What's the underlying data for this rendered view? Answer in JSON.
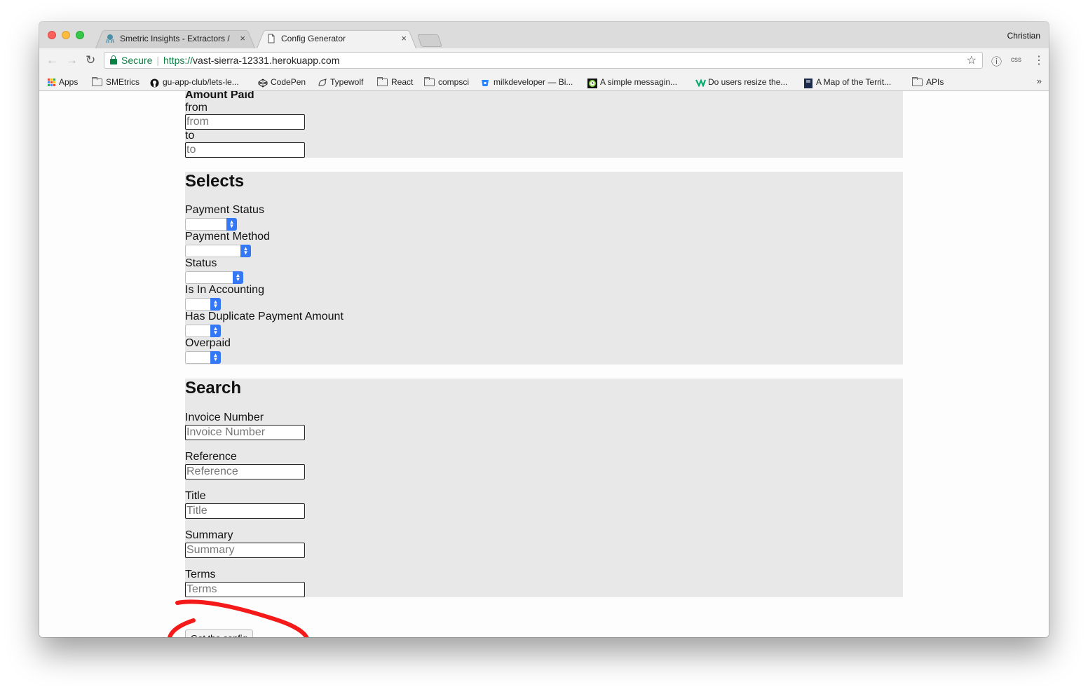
{
  "browser": {
    "profile_name": "Christian",
    "tabs": [
      {
        "title": "Smetric Insights - Extractors /",
        "active": false
      },
      {
        "title": "Config Generator",
        "active": true
      }
    ],
    "close_glyph": "×",
    "address": {
      "secure_label": "Secure",
      "scheme": "https://",
      "host": "vast-sierra-12331.herokuapp.com"
    },
    "toolbar_extension_label": "css",
    "bookmarks": [
      {
        "label": "Apps",
        "icon": "apps-grid-icon"
      },
      {
        "label": "SMEtrics",
        "icon": "folder-icon"
      },
      {
        "label": "gu-app-club/lets-le...",
        "icon": "github-icon"
      },
      {
        "label": "CodePen",
        "icon": "codepen-icon"
      },
      {
        "label": "Typewolf",
        "icon": "typewolf-icon"
      },
      {
        "label": "React",
        "icon": "folder-icon"
      },
      {
        "label": "compsci",
        "icon": "folder-icon"
      },
      {
        "label": "milkdeveloper — Bi...",
        "icon": "bitbucket-icon"
      },
      {
        "label": "A simple messagin...",
        "icon": "clock-icon"
      },
      {
        "label": "Do users resize the...",
        "icon": "medium-icon"
      },
      {
        "label": "A Map of the Territ...",
        "icon": "book-icon"
      },
      {
        "label": "APIs",
        "icon": "folder-icon"
      }
    ],
    "bookmarks_overflow": "»"
  },
  "page": {
    "amount_paid": {
      "heading": "Amount Paid",
      "from_label": "from",
      "from_placeholder": "from",
      "to_label": "to",
      "to_placeholder": "to"
    },
    "selects": {
      "heading": "Selects",
      "fields": [
        {
          "label": "Payment Status",
          "value": ""
        },
        {
          "label": "Payment Method",
          "value": ""
        },
        {
          "label": "Status",
          "value": ""
        },
        {
          "label": "Is In Accounting",
          "value": ""
        },
        {
          "label": "Has Duplicate Payment Amount",
          "value": ""
        },
        {
          "label": "Overpaid",
          "value": ""
        }
      ]
    },
    "search": {
      "heading": "Search",
      "fields": [
        {
          "label": "Invoice Number",
          "placeholder": "Invoice Number"
        },
        {
          "label": "Reference",
          "placeholder": "Reference"
        },
        {
          "label": "Title",
          "placeholder": "Title"
        },
        {
          "label": "Summary",
          "placeholder": "Summary"
        },
        {
          "label": "Terms",
          "placeholder": "Terms"
        }
      ]
    },
    "submit_label": "Get the config"
  },
  "colors": {
    "section_bg": "#e8e8e8",
    "select_arrow": "#3478f6",
    "secure_green": "#0b8043",
    "annotation_red": "#f41a1a"
  }
}
